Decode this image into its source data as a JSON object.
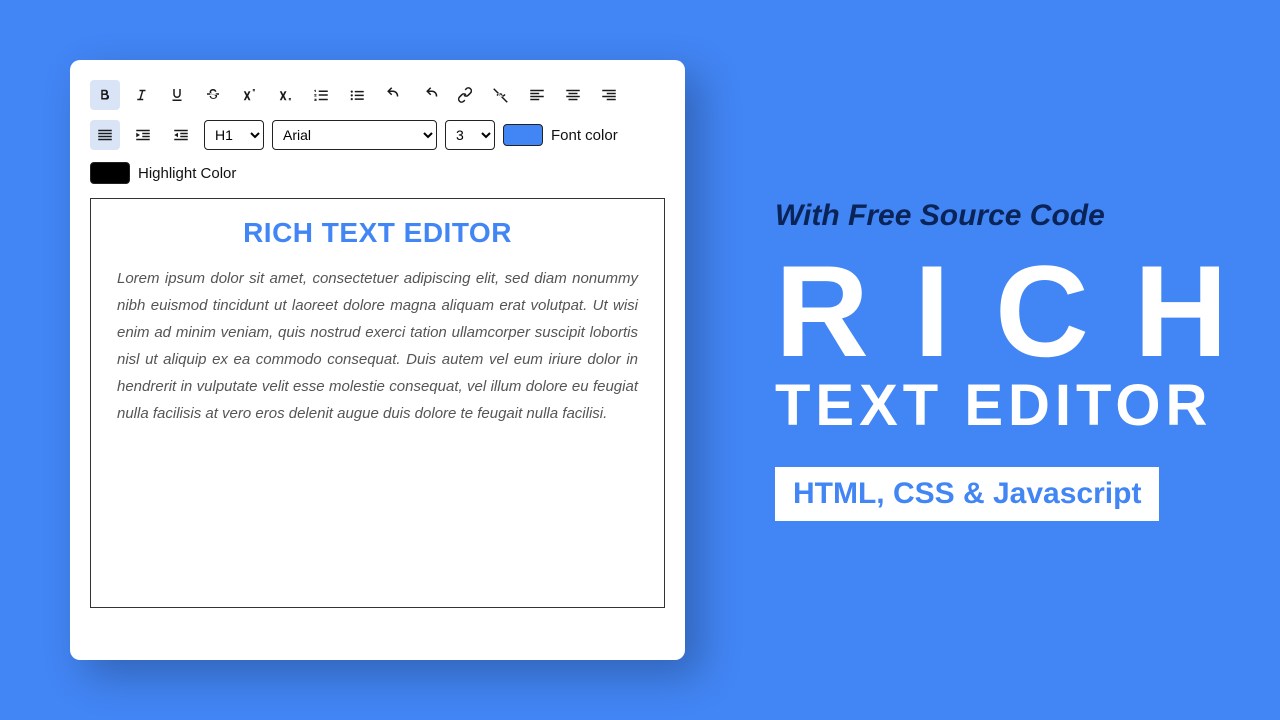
{
  "toolbar": {
    "heading_value": "H1",
    "font_value": "Arial",
    "size_value": "3",
    "font_color_label": "Font color",
    "highlight_color_label": "Highlight Color"
  },
  "colors": {
    "font_color": "#4285f4",
    "highlight_color": "#000000"
  },
  "content": {
    "title": "RICH TEXT EDITOR",
    "body": "Lorem ipsum dolor sit amet, consectetuer adipiscing elit, sed diam nonummy nibh euismod tincidunt ut laoreet dolore magna aliquam erat volutpat. Ut wisi enim ad minim veniam, quis nostrud exerci tation ullamcorper suscipit lobortis nisl ut aliquip ex ea commodo consequat. Duis autem vel eum iriure dolor in hendrerit in vulputate velit esse molestie consequat, vel illum dolore eu feugiat nulla facilisis at vero eros delenit augue duis dolore te feugait nulla facilisi."
  },
  "promo": {
    "subtitle": "With Free Source Code",
    "line1": "RICH",
    "line2": "TEXT EDITOR",
    "badge": "HTML, CSS & Javascript"
  }
}
